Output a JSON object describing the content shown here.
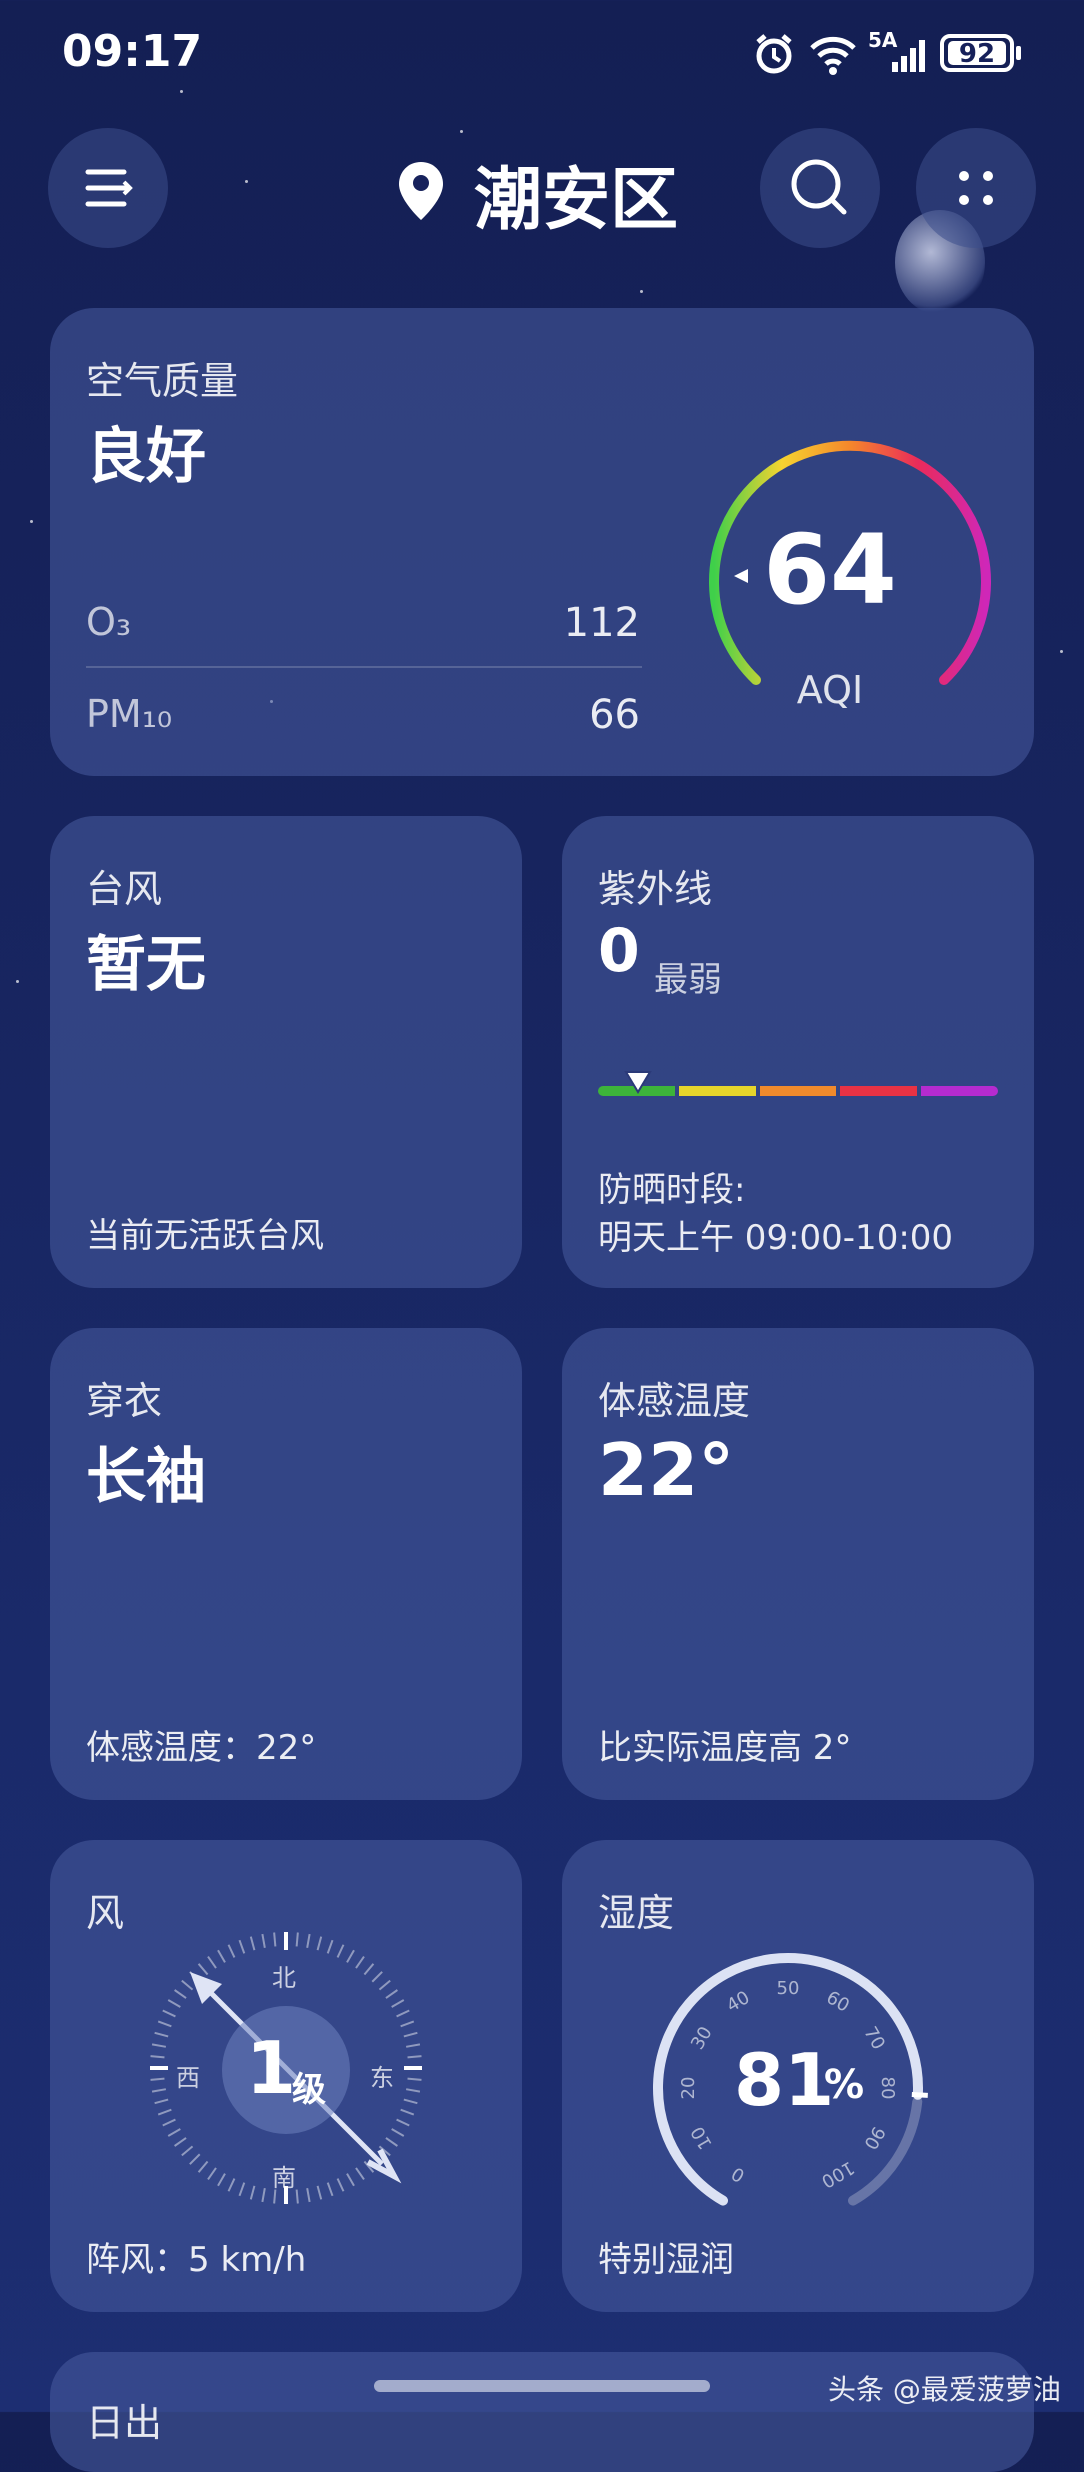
{
  "status_bar": {
    "time": "09:17",
    "network": "5A",
    "battery": "92"
  },
  "header": {
    "location": "潮安区"
  },
  "air_quality": {
    "title": "空气质量",
    "level": "良好",
    "o3_label": "O₃",
    "o3_value": "112",
    "pm10_label": "PM₁₀",
    "pm10_value": "66",
    "aqi": "64",
    "aqi_label": "AQI"
  },
  "typhoon": {
    "title": "台风",
    "value": "暂无",
    "note": "当前无活跃台风"
  },
  "uv": {
    "title": "紫外线",
    "value": "0",
    "level": "最弱",
    "note_label": "防晒时段:",
    "note_time": "明天上午 09:00-10:00"
  },
  "clothing": {
    "title": "穿衣",
    "value": "长袖",
    "note": "体感温度：22°"
  },
  "feels_like": {
    "title": "体感温度",
    "value": "22°",
    "note": "比实际温度高 2°"
  },
  "wind": {
    "title": "风",
    "level": "1",
    "unit": "级",
    "north": "北",
    "south": "南",
    "east": "东",
    "west": "西",
    "gust": "阵风：5 km/h"
  },
  "humidity": {
    "title": "湿度",
    "value": "81",
    "percent": "%",
    "percent_value": 81,
    "note": "特别湿润",
    "ticks": [
      "0",
      "10",
      "20",
      "30",
      "40",
      "50",
      "60",
      "70",
      "80",
      "90",
      "100"
    ]
  },
  "next_card": {
    "title": "日出"
  },
  "watermark": "头条 @最爱菠萝油",
  "colors": {
    "card": "#485ca0",
    "aqi_gradient": [
      "#3fd04a",
      "#f6d330",
      "#f5872b",
      "#ea2b5a",
      "#cf27b8"
    ],
    "uv_scale": [
      "#3db43a",
      "#e6d52b",
      "#f08a2c",
      "#e83244",
      "#b52bd0"
    ]
  }
}
